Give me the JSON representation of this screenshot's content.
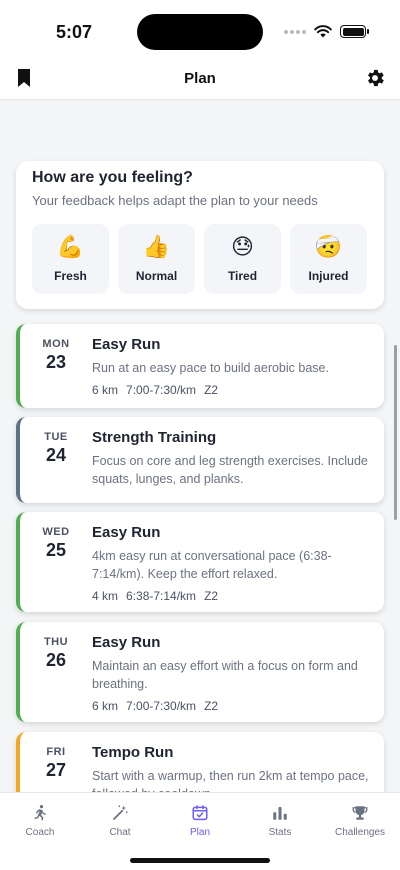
{
  "status": {
    "time": "5:07"
  },
  "nav": {
    "title": "Plan",
    "left_icon": "bookmark-icon",
    "right_icon": "gear-icon"
  },
  "feeling": {
    "title": "How are you feeling?",
    "subtitle": "Your feedback helps adapt the plan to your needs",
    "options": [
      {
        "emoji": "💪",
        "label": "Fresh"
      },
      {
        "emoji": "👍",
        "label": "Normal"
      },
      {
        "emoji": "😓",
        "label": "Tired"
      },
      {
        "emoji": "🤕",
        "label": "Injured"
      }
    ]
  },
  "workouts": [
    {
      "dow": "MON",
      "day": "23",
      "title": "Easy Run",
      "desc": "Run at an easy pace to build aerobic base.",
      "distance": "6 km",
      "pace": "7:00-7:30/km",
      "zone": "Z2",
      "color": "#4caf50"
    },
    {
      "dow": "TUE",
      "day": "24",
      "title": "Strength Training",
      "desc": "Focus on core and leg strength exercises. Include squats, lunges, and planks.",
      "distance": "",
      "pace": "",
      "zone": "",
      "color": "#5f7285"
    },
    {
      "dow": "WED",
      "day": "25",
      "title": "Easy Run",
      "desc": "4km easy run at conversational pace (6:38-7:14/km). Keep the effort relaxed.",
      "distance": "4 km",
      "pace": "6:38-7:14/km",
      "zone": "Z2",
      "color": "#4caf50"
    },
    {
      "dow": "THU",
      "day": "26",
      "title": "Easy Run",
      "desc": "Maintain an easy effort with a focus on form and breathing.",
      "distance": "6 km",
      "pace": "7:00-7:30/km",
      "zone": "Z2",
      "color": "#4caf50"
    },
    {
      "dow": "FRI",
      "day": "27",
      "title": "Tempo Run",
      "desc": "Start with a warmup, then run 2km at tempo pace, followed by cooldown.",
      "distance": "",
      "pace": "",
      "zone": "",
      "color": "#f5a623"
    }
  ],
  "tabs": [
    {
      "label": "Coach",
      "icon": "runner-icon",
      "active": false
    },
    {
      "label": "Chat",
      "icon": "magic-wand-icon",
      "active": false
    },
    {
      "label": "Plan",
      "icon": "calendar-check-icon",
      "active": true
    },
    {
      "label": "Stats",
      "icon": "bar-chart-icon",
      "active": false
    },
    {
      "label": "Challenges",
      "icon": "trophy-icon",
      "active": false
    }
  ],
  "colors": {
    "accent": "#6d5cf5",
    "tab_inactive": "#6b7280"
  }
}
